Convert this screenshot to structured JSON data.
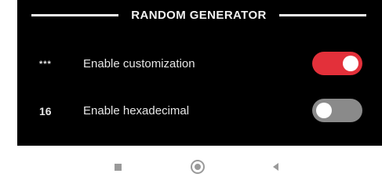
{
  "section": {
    "title": "RANDOM GENERATOR"
  },
  "settings": [
    {
      "icon_text": "***",
      "icon": "asterisks-icon",
      "label": "Enable customization",
      "enabled": true,
      "toggle_color": "#e3303a"
    },
    {
      "icon_text": "16",
      "icon": "hex-16-icon",
      "label": "Enable hexadecimal",
      "enabled": false,
      "toggle_color": "#8a8a8a"
    }
  ],
  "navbar": {
    "buttons": [
      {
        "icon": "recent-apps-icon"
      },
      {
        "icon": "home-icon"
      },
      {
        "icon": "back-icon"
      }
    ]
  },
  "colors": {
    "panel_background": "#000000",
    "text": "#e6e6e6",
    "accent": "#e3303a"
  }
}
